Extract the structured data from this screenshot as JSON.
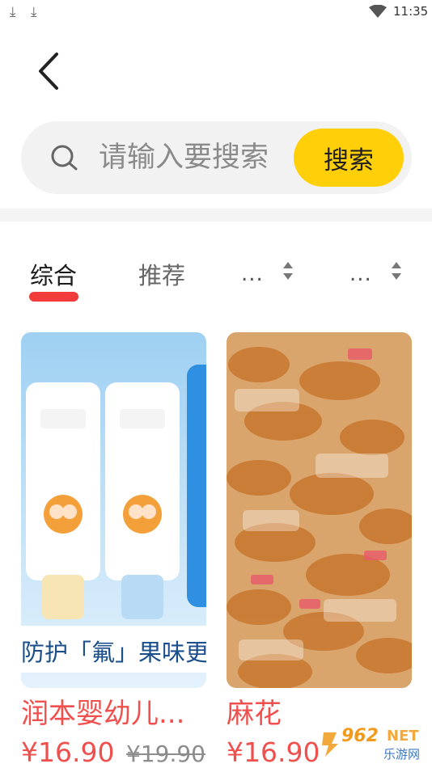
{
  "status_bar": {
    "time": "11:35",
    "icons": [
      "download-icon",
      "download-icon",
      "wifi-icon"
    ]
  },
  "nav": {
    "back_icon": "chevron-left-icon"
  },
  "search": {
    "placeholder": "请输入要搜索",
    "button_label": "搜索",
    "button_color": "#ffcf0a"
  },
  "tabs": [
    {
      "label": "综合",
      "active": true
    },
    {
      "label": "推荐",
      "active": false
    },
    {
      "label": "...",
      "sortable": true
    },
    {
      "label": "...",
      "sortable": true
    }
  ],
  "accent_color": "#f23b3b",
  "products": [
    {
      "name": "润本婴幼儿...",
      "price": "¥16.90",
      "original_price": "¥19.90",
      "banner_text": "防护「氟」果味更"
    },
    {
      "name": "麻花",
      "price": "¥16.90"
    }
  ],
  "watermark": {
    "brand": "962",
    "suffix": "NET",
    "site": "乐游网"
  }
}
